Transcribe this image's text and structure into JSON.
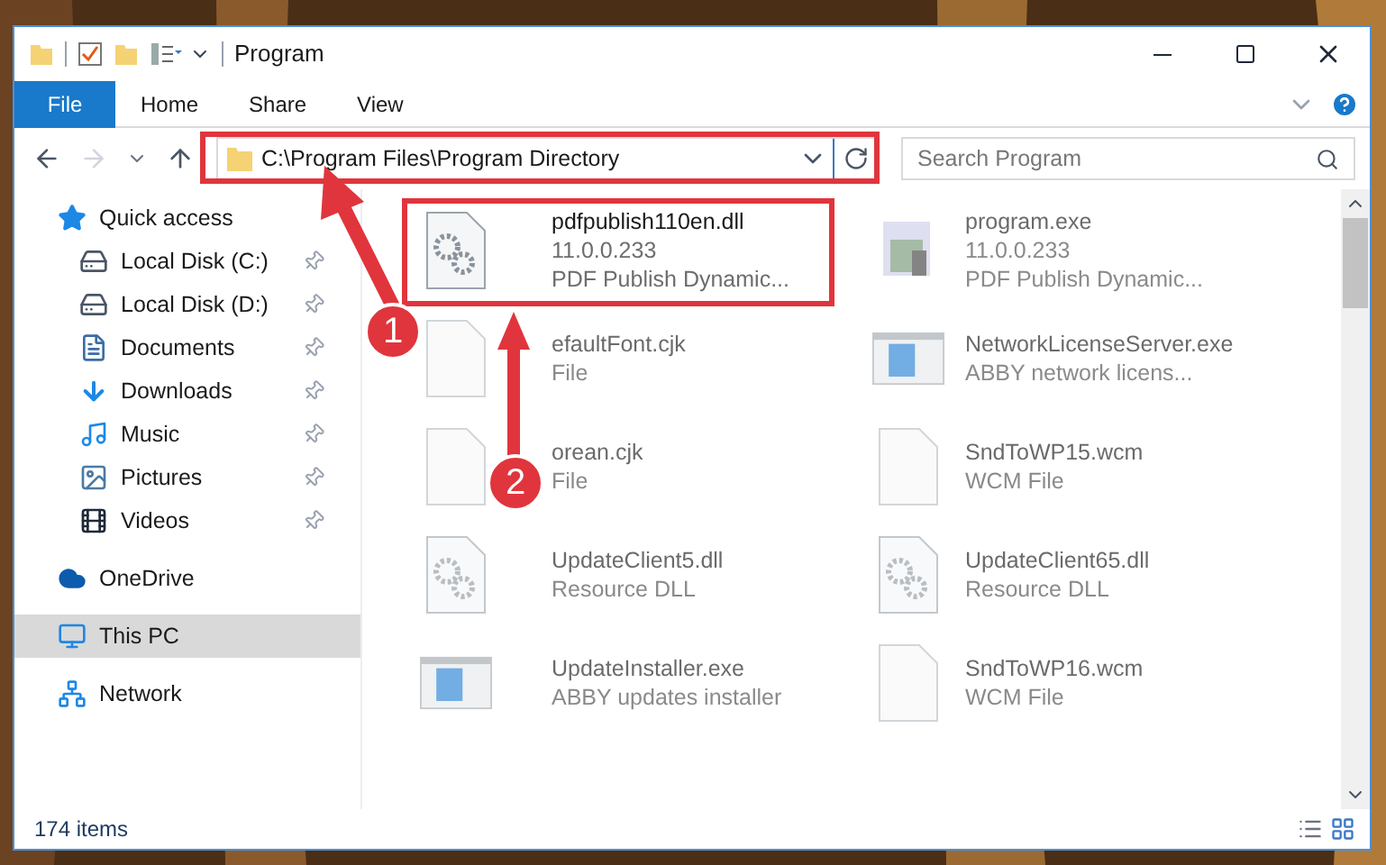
{
  "window": {
    "title": "Program"
  },
  "ribbon_tabs": [
    {
      "label": "File",
      "selected": true
    },
    {
      "label": "Home",
      "selected": false
    },
    {
      "label": "Share",
      "selected": false
    },
    {
      "label": "View",
      "selected": false
    }
  ],
  "address": {
    "value": "C:\\Program Files\\Program Directory"
  },
  "search": {
    "placeholder": "Search Program"
  },
  "sidebar": {
    "items": [
      {
        "label": "Quick access",
        "kind": "star",
        "selected": false,
        "children": [
          {
            "label": "Local Disk (C:)",
            "kind": "drive",
            "selected": false,
            "pinned": true
          },
          {
            "label": "Local Disk (D:)",
            "kind": "drive",
            "selected": false,
            "pinned": true
          },
          {
            "label": "Documents",
            "kind": "docs",
            "selected": false,
            "pinned": true
          },
          {
            "label": "Downloads",
            "kind": "download",
            "selected": false,
            "pinned": true
          },
          {
            "label": "Music",
            "kind": "music",
            "selected": false,
            "pinned": true
          },
          {
            "label": "Pictures",
            "kind": "pictures",
            "selected": false,
            "pinned": true
          },
          {
            "label": "Videos",
            "kind": "videos",
            "selected": false,
            "pinned": true
          }
        ]
      },
      {
        "label": "OneDrive",
        "kind": "cloud",
        "selected": false
      },
      {
        "label": "This PC",
        "kind": "pc",
        "selected": true
      },
      {
        "label": "Network",
        "kind": "network",
        "selected": false
      }
    ]
  },
  "files": [
    {
      "name": "pdfpublish110en.dll",
      "lines": [
        "11.0.0.233",
        "PDF Publish Dynamic..."
      ],
      "kind": "dll",
      "dimmed": false
    },
    {
      "name": "program.exe",
      "lines": [
        "11.0.0.233",
        "PDF Publish Dynamic..."
      ],
      "kind": "exe",
      "dimmed": true
    },
    {
      "name": "efaultFont.cjk",
      "lines": [
        "File"
      ],
      "kind": "file",
      "dimmed": true
    },
    {
      "name": "NetworkLicenseServer.exe",
      "lines": [
        "ABBY network licens..."
      ],
      "kind": "app",
      "dimmed": true
    },
    {
      "name": "orean.cjk",
      "lines": [
        "File"
      ],
      "kind": "file",
      "dimmed": true
    },
    {
      "name": "SndToWP15.wcm",
      "lines": [
        "WCM File"
      ],
      "kind": "file",
      "dimmed": true
    },
    {
      "name": "UpdateClient5.dll",
      "lines": [
        "Resource DLL"
      ],
      "kind": "dll",
      "dimmed": true
    },
    {
      "name": "UpdateClient65.dll",
      "lines": [
        "Resource DLL"
      ],
      "kind": "dll",
      "dimmed": true
    },
    {
      "name": "UpdateInstaller.exe",
      "lines": [
        "ABBY updates installer"
      ],
      "kind": "app",
      "dimmed": true
    },
    {
      "name": "SndToWP16.wcm",
      "lines": [
        "WCM File"
      ],
      "kind": "file",
      "dimmed": true
    }
  ],
  "status_bar": {
    "count": "174 items"
  },
  "annotations": [
    {
      "number": "1"
    },
    {
      "number": "2"
    }
  ]
}
